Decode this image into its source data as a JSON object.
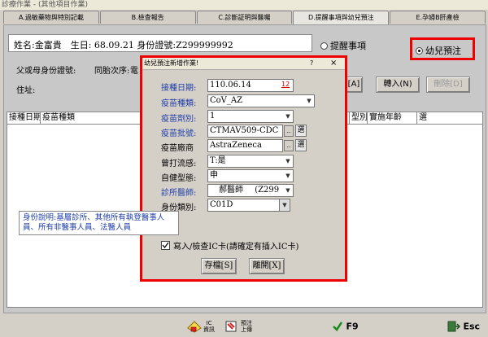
{
  "window": {
    "title": "診療作業 - (其他項目作業)"
  },
  "tabs": [
    {
      "label": "A.過敏藥物與特別記載",
      "active": false
    },
    {
      "label": "B.檢查報告",
      "active": false
    },
    {
      "label": "C.診斷証明與醫囑",
      "active": false
    },
    {
      "label": "D.提醒事項與幼兒預注",
      "active": true
    },
    {
      "label": "E.孕婦B肝產檢",
      "active": false
    }
  ],
  "patient": {
    "info": "姓名:金富貴　生日: 68.09.21 身份證號:Z299999992",
    "parent_id_label": "父或母身份證號:",
    "birth_order_label": "同胎次序:",
    "phone_label": "電",
    "address_label": "住址:"
  },
  "mode": {
    "reminder_label": "提醒事項",
    "child_vaccine_label": "幼兒預注",
    "selected": "child_vaccine"
  },
  "actions": {
    "btn_a_label": "[A]",
    "transfer_label": "轉入(N)",
    "delete_label": "刪除[D]"
  },
  "grid": {
    "headers": [
      "接種日期",
      "疫苗種類",
      "型別",
      "實施年齡",
      "選"
    ]
  },
  "dialog": {
    "title": "幼兒預注新增作業!",
    "help": "?",
    "close": "×",
    "fields": {
      "date_label": "接種日期:",
      "date_value": "110.06.14",
      "date_badge": "12",
      "type_label": "疫苗種類:",
      "type_value": "CoV_AZ",
      "dose_label": "疫苗劑別:",
      "dose_value": "1",
      "lot_label": "疫苗批號:",
      "lot_value": "CTMAV509-CDC",
      "maker_label": "疫苗廠商",
      "maker_value": "AstraZeneca",
      "flu_label": "曾打流感:",
      "flu_value": "T:是",
      "self_label": "自健型態:",
      "self_value": "申",
      "doctor_label": "診所醫師:",
      "doctor_value": "郝醫師",
      "doctor_code": "(Z299",
      "identity_label": "身份類別:",
      "identity_value": "C01D"
    },
    "select_btn": "選",
    "ellipsis": "..",
    "note": "身份說明:基層診所、其他所有執登醫事人員、所有非醫事人員、法醫人員",
    "checkbox_label": "寫入/檢查IC卡(請確定有插入IC卡)",
    "checkbox_checked": true,
    "save_label": "存檔[S]",
    "exit_label": "離開[X]"
  },
  "bottombar": {
    "ic_label_1": "IC",
    "ic_label_2": "資訊",
    "upload_label_1": "預注",
    "upload_label_2": "上傳",
    "f9_label": "F9",
    "esc_label": "Esc"
  },
  "colors": {
    "highlight": "#e00000",
    "blue_label": "#1f3ea8"
  }
}
